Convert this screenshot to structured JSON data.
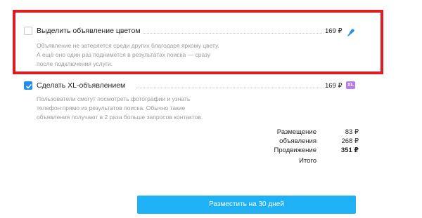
{
  "options": [
    {
      "title": "Выделить объявление цветом",
      "price": "169 ₽",
      "checked": false,
      "icon": "paint-drop-icon",
      "description": [
        "Объявление не затеряется среди других благодаря яркому цвету.",
        "А ещё оно один раз поднимется в результатах поиска — сразу",
        "после подключения услуги."
      ]
    },
    {
      "title": "Сделать XL-объявлением",
      "price": "169 ₽",
      "checked": true,
      "badge": "XL",
      "description": [
        "Пользователи смогут посмотреть фотографии и узнать",
        "телефон прямо из результатов поиска. Обычно такие",
        "объявления получают в 2 раза больше запросов контактов."
      ]
    }
  ],
  "summary": {
    "rows": [
      {
        "label": "Размещение",
        "value": "83 ₽"
      },
      {
        "label": "объявления",
        "value": "268 ₽"
      },
      {
        "label": "Продвижение",
        "value": "351 ₽"
      },
      {
        "label": "Итого",
        "value": ""
      }
    ]
  },
  "submit_button": {
    "label": "Разместить на 30 дней"
  },
  "colors": {
    "highlight_border": "#e11b22",
    "accent_blue": "#1f8fe8",
    "button_blue": "#1fb1f5",
    "xl_badge": "#b57cf0"
  }
}
